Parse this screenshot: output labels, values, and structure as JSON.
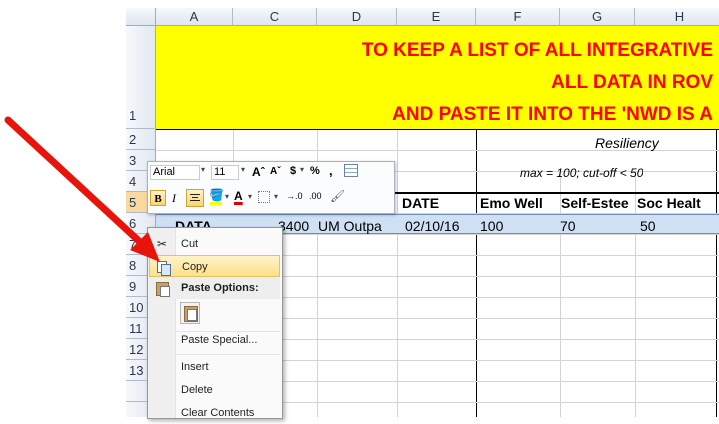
{
  "columns": [
    "A",
    "C",
    "D",
    "E",
    "F",
    "G",
    "H"
  ],
  "rows": [
    "1",
    "2",
    "3",
    "4",
    "5",
    "6",
    "7",
    "8",
    "9",
    "10",
    "11",
    "12",
    "13"
  ],
  "banner": {
    "line1": "TO KEEP A LIST OF ALL INTEGRATIVE",
    "line2": "ALL DATA IN ROV",
    "line3": "AND PASTE IT INTO THE 'NWD IS A"
  },
  "row2": {
    "resiliency": "Resiliency"
  },
  "row3": {
    "max": "max = 100; cut-off < 50"
  },
  "row4": {
    "date": "DATE",
    "emo": "Emo Well",
    "self": "Self-Estee",
    "soc": "Soc Healt"
  },
  "row5": {
    "a": "DATA",
    "c": "3400",
    "d": "UM Outpa",
    "e": "02/10/16",
    "f": "100",
    "g": "70",
    "h": "50"
  },
  "mini_toolbar": {
    "font": "Arial",
    "size": "11",
    "grow": "Aˆ",
    "shrink": "Aˇ",
    "currency": "$",
    "percent": "%",
    "comma": ",",
    "bold": "B",
    "italic": "I",
    "font_color": "A",
    "inc_decimal": "→.0",
    "dec_decimal": ".00"
  },
  "context_menu": {
    "cut": "Cut",
    "copy": "Copy",
    "paste_options": "Paste Options:",
    "paste_special": "Paste Special...",
    "insert": "Insert",
    "delete": "Delete",
    "clear_contents": "Clear Contents"
  },
  "colors": {
    "banner_bg": "#ffff00",
    "banner_text": "#ff0000",
    "arrow": "#e8140c",
    "selected_row": "#cfe0f5",
    "menu_highlight": "#fde08a"
  }
}
